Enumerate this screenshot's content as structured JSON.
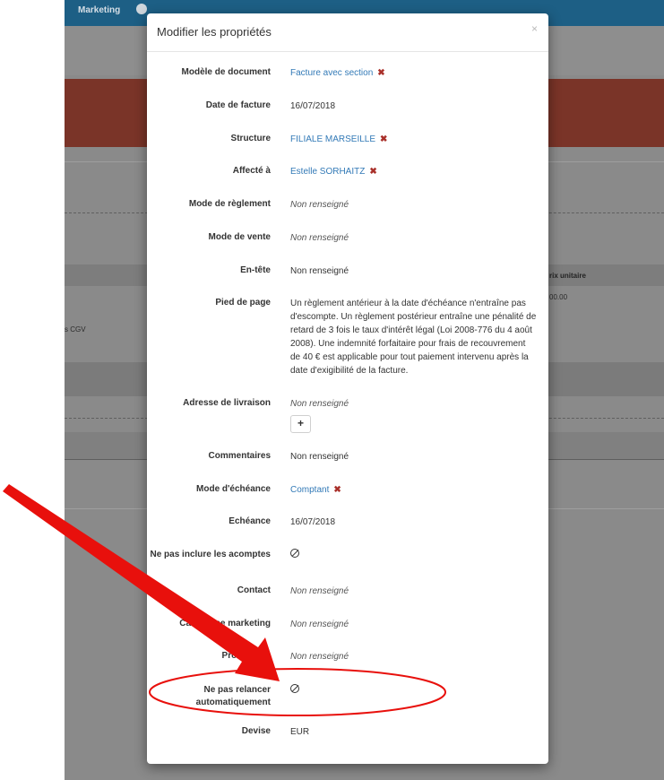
{
  "background": {
    "nav_item": "Marketing",
    "table_header_fragment": "rix unitaire",
    "price_fragment": "00.00",
    "cgv_fragment": "s CGV"
  },
  "modal": {
    "title": "Modifier les propriétés",
    "close": "×",
    "fields": [
      {
        "label": "Modèle de document",
        "value": "Facture avec section"
      },
      {
        "label": "Date de facture",
        "value": "16/07/2018"
      },
      {
        "label": "Structure",
        "value": "FILIALE MARSEILLE"
      },
      {
        "label": "Affecté à",
        "value": "Estelle SORHAITZ"
      },
      {
        "label": "Mode de règlement",
        "value": "Non renseigné"
      },
      {
        "label": "Mode de vente",
        "value": "Non renseigné"
      },
      {
        "label": "En-tête",
        "value": "Non renseigné"
      },
      {
        "label": "Pied de page",
        "value": "Un règlement antérieur à la date d'échéance n'entraîne pas d'escompte. Un règlement postérieur entraîne une pénalité de retard de 3 fois le taux d'intérêt légal (Loi 2008-776 du 4 août 2008). Une indemnité forfaitaire pour frais de recouvrement de 40 € est applicable pour tout paiement intervenu après la date d'exigibilité de la facture."
      },
      {
        "label": "Adresse de livraison",
        "value": "Non renseigné",
        "button": "+"
      },
      {
        "label": "Commentaires",
        "value": "Non renseigné"
      },
      {
        "label": "Mode d'échéance",
        "value": "Comptant"
      },
      {
        "label": "Echéance",
        "value": "16/07/2018"
      },
      {
        "label": "Ne pas inclure les acomptes",
        "value": ""
      },
      {
        "label": "Contact",
        "value": "Non renseigné"
      },
      {
        "label": "Campagne marketing",
        "value": "Non renseigné"
      },
      {
        "label": "Prospectus",
        "value": "Non renseigné"
      },
      {
        "label": "Ne pas relancer automatiquement",
        "value": ""
      },
      {
        "label": "Devise",
        "value": "EUR"
      }
    ]
  },
  "icons": {
    "remove": "✖",
    "disabled": "no-symbol-icon"
  },
  "colors": {
    "nav": "#1d5f85",
    "link": "#337ab7",
    "remove": "#a9302a",
    "annotation": "#e8100c"
  }
}
